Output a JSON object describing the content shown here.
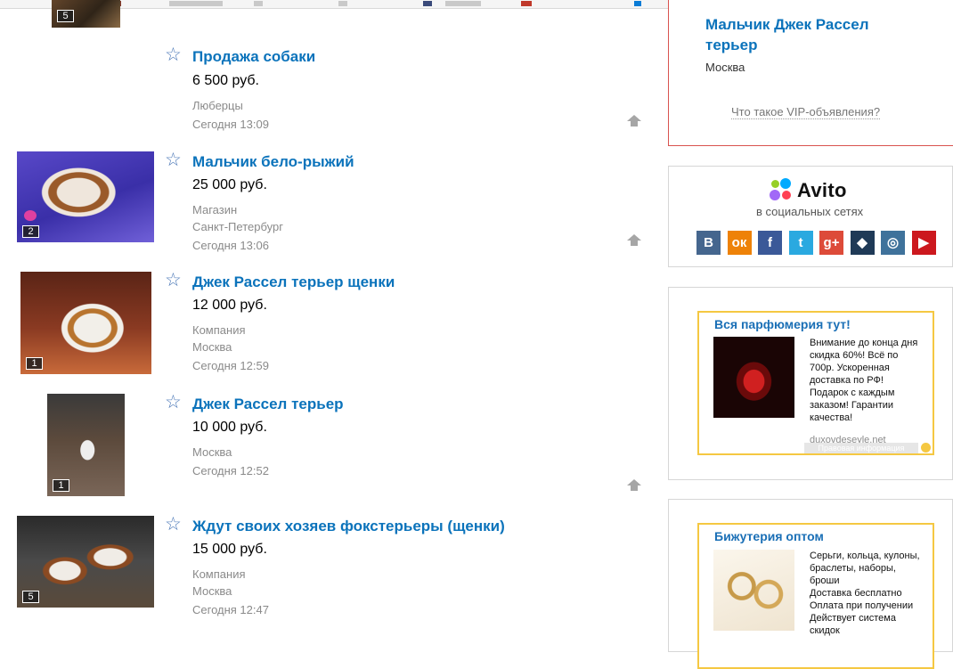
{
  "listings": [
    {
      "thumb_count": "5"
    },
    {
      "title": "Продажа собаки",
      "price": "6 500 руб.",
      "lines": [
        "Люберцы",
        "Сегодня 13:09"
      ]
    },
    {
      "title": "Мальчик бело-рыжий",
      "price": "25 000 руб.",
      "lines": [
        "Магазин",
        "Санкт-Петербург",
        "Сегодня 13:06"
      ],
      "thumb_count": "2"
    },
    {
      "title": "Джек Рассел терьер щенки",
      "price": "12 000 руб.",
      "lines": [
        "Компания",
        "Москва",
        "Сегодня 12:59"
      ],
      "thumb_count": "1"
    },
    {
      "title": "Джек Рассел терьер",
      "price": "10 000 руб.",
      "lines": [
        "Москва",
        "Сегодня 12:52"
      ],
      "thumb_count": "1"
    },
    {
      "title": "Ждут своих хозяев фокстерьеры (щенки)",
      "price": "15 000 руб.",
      "lines": [
        "Компания",
        "Москва",
        "Сегодня 12:47"
      ],
      "thumb_count": "5"
    }
  ],
  "vip": {
    "title": "Мальчик Джек Рассел терьер",
    "city": "Москва",
    "link": "Что такое VIP-объявления?"
  },
  "social": {
    "brand": "Avito",
    "subtitle": "в социальных сетях",
    "icons": [
      {
        "name": "vk-icon",
        "glyph": "В",
        "color": "#45668e"
      },
      {
        "name": "odnoklassniki-icon",
        "glyph": "ок",
        "color": "#ee8208"
      },
      {
        "name": "facebook-icon",
        "glyph": "f",
        "color": "#3b5998"
      },
      {
        "name": "twitter-icon",
        "glyph": "t",
        "color": "#2aa9e0"
      },
      {
        "name": "google-plus-icon",
        "glyph": "g+",
        "color": "#dd4b39"
      },
      {
        "name": "livejournal-icon",
        "glyph": "◆",
        "color": "#1f3a57"
      },
      {
        "name": "instagram-icon",
        "glyph": "◎",
        "color": "#3f729b"
      },
      {
        "name": "youtube-icon",
        "glyph": "▶",
        "color": "#cc181e"
      }
    ]
  },
  "ads": [
    {
      "title": "Вся парфюмерия тут!",
      "text": [
        "Внимание до конца дня",
        "скидка 60%! Всё по",
        "700р. Ускоренная",
        "доставка по РФ!",
        "Подарок с каждым",
        "заказом! Гарантии",
        "качества!"
      ],
      "url": "duxovdeseyle.net",
      "legal": "Правовая информация"
    },
    {
      "title": "Бижутерия оптом",
      "text": [
        "Серьги, кольца, кулоны,",
        "браслеты, наборы,",
        "броши",
        "Доставка бесплатно",
        "Оплата при получении",
        "Действует система",
        "скидок"
      ]
    }
  ]
}
